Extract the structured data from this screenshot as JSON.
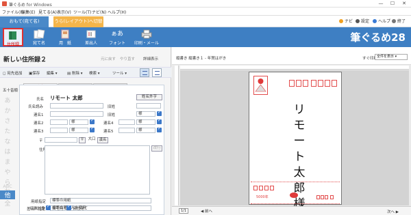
{
  "window": {
    "title": "筆ぐるめ for Windows",
    "minimize": "—",
    "maximize": "☐",
    "close": "✕"
  },
  "menu": [
    "ファイル(F)",
    "編集(E)",
    "見てる(A)",
    "表示(V)",
    "ツール(T)",
    "ナビ(N)",
    "ヘルプ(H)"
  ],
  "mode": {
    "front": "おもて(宛て名)",
    "back": "うら(レイアウト)へ切替"
  },
  "right_tools": {
    "navi": "ナビ",
    "settings": "設定",
    "help": "ヘルプ",
    "exit": "終了"
  },
  "ribbon": {
    "items": [
      {
        "label": "住所録",
        "selected": true
      },
      {
        "label": "宛て名",
        "selected": false
      },
      {
        "label": "用　紙",
        "selected": false
      },
      {
        "label": "差出人",
        "selected": false
      },
      {
        "label": "フォント",
        "selected": false,
        "glyph": "ぁあ"
      },
      {
        "label": "印刷・メール",
        "selected": false
      }
    ],
    "brand": "筆ぐるめ28"
  },
  "left": {
    "title": "新しい住所録２",
    "top_buttons": [
      "元に戻す",
      "やり直す",
      "詳細表示"
    ],
    "toolbar": {
      "add": "宛先追加",
      "save": "保存",
      "edit": "編集",
      "delete": "削除",
      "search": "検索",
      "tools": "ツール"
    },
    "sort_label": "五十音順",
    "kana": [
      "あ",
      "か",
      "さ",
      "た",
      "な",
      "は",
      "ま",
      "や",
      "ら",
      "わ",
      "ABC",
      "他",
      "全"
    ],
    "form_tabs": [
      "自宅",
      "会社",
      "メモ"
    ],
    "fields": {
      "name_label": "氏名",
      "name_value": "リモート 太郎",
      "kana_label": "氏名読み",
      "joint1": "連名1",
      "joint2": "連名2",
      "joint3": "連名3",
      "joint4": "連名4",
      "joint5": "連名5",
      "old_name": "旧姓",
      "honorific": "様",
      "postal": "〒",
      "address": "住所",
      "name_btn": "姓名外字",
      "zip_btn": "〒",
      "large_btn": "大口",
      "kana_btn": "漢名",
      "newline_btn": "改行",
      "cat_label": "用紙指定",
      "cat_value": "標準の用紙",
      "sender_label": "差出人指定",
      "sender_value": "標準の差出人を使用",
      "print_label": "印刷対象",
      "print_home": "自宅宛て",
      "print_company": "会社宛て"
    }
  },
  "right": {
    "title": "縦書き 縦書き１ - 年賀はがき",
    "print_label": "すぐ印刷",
    "print_select": "全件を表示",
    "card_name": [
      "リ",
      "モ",
      "ー",
      "ト",
      "太",
      "郎",
      "様"
    ],
    "sender_zip": "5000年",
    "page": "1/1",
    "prev": "◀ 前へ",
    "next": "次へ ▶"
  }
}
